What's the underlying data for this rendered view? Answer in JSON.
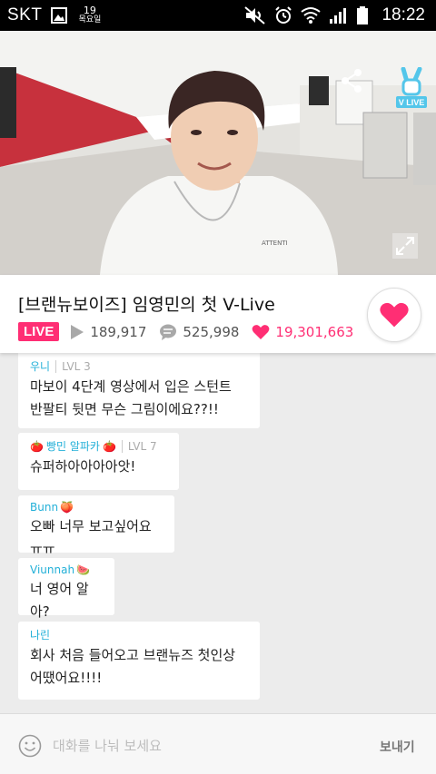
{
  "status_bar": {
    "carrier": "SKT",
    "date_day": "19",
    "date_weekday": "목요일",
    "time": "18:22"
  },
  "video": {
    "brand_label": "V LIVE"
  },
  "broadcast": {
    "title": "[브랜뉴보이즈] 임영민의 첫 V-Live",
    "live_label": "LIVE",
    "plays": "189,917",
    "comments": "525,998",
    "hearts": "19,301,663"
  },
  "chat": {
    "messages": [
      {
        "user": "우니",
        "level": "LVL 3",
        "text": "마보이 4단계 영상에서 입은 스턴트\n반팔티 뒷면 무슨 그림이에요??!!"
      },
      {
        "user": "빵민 알파카",
        "level": "LVL 7",
        "text": "슈퍼하아아아아앗!"
      },
      {
        "user": "Bunn",
        "level": "",
        "text": "오빠 너무 보고싶어요 ㅠㅠ"
      },
      {
        "user": "Viunnah",
        "level": "",
        "text": "너 영어 알아?"
      },
      {
        "user": "나린",
        "level": "",
        "text": "회사 처음 들어오고 브랜뉴즈 첫인상\n어땠어요!!!!"
      }
    ]
  },
  "input": {
    "placeholder": "대화를 나눠 보세요",
    "send_label": "보내기"
  },
  "colors": {
    "accent": "#ff2e74",
    "username": "#23b0d8",
    "vlive_blue": "#54c6ea"
  }
}
